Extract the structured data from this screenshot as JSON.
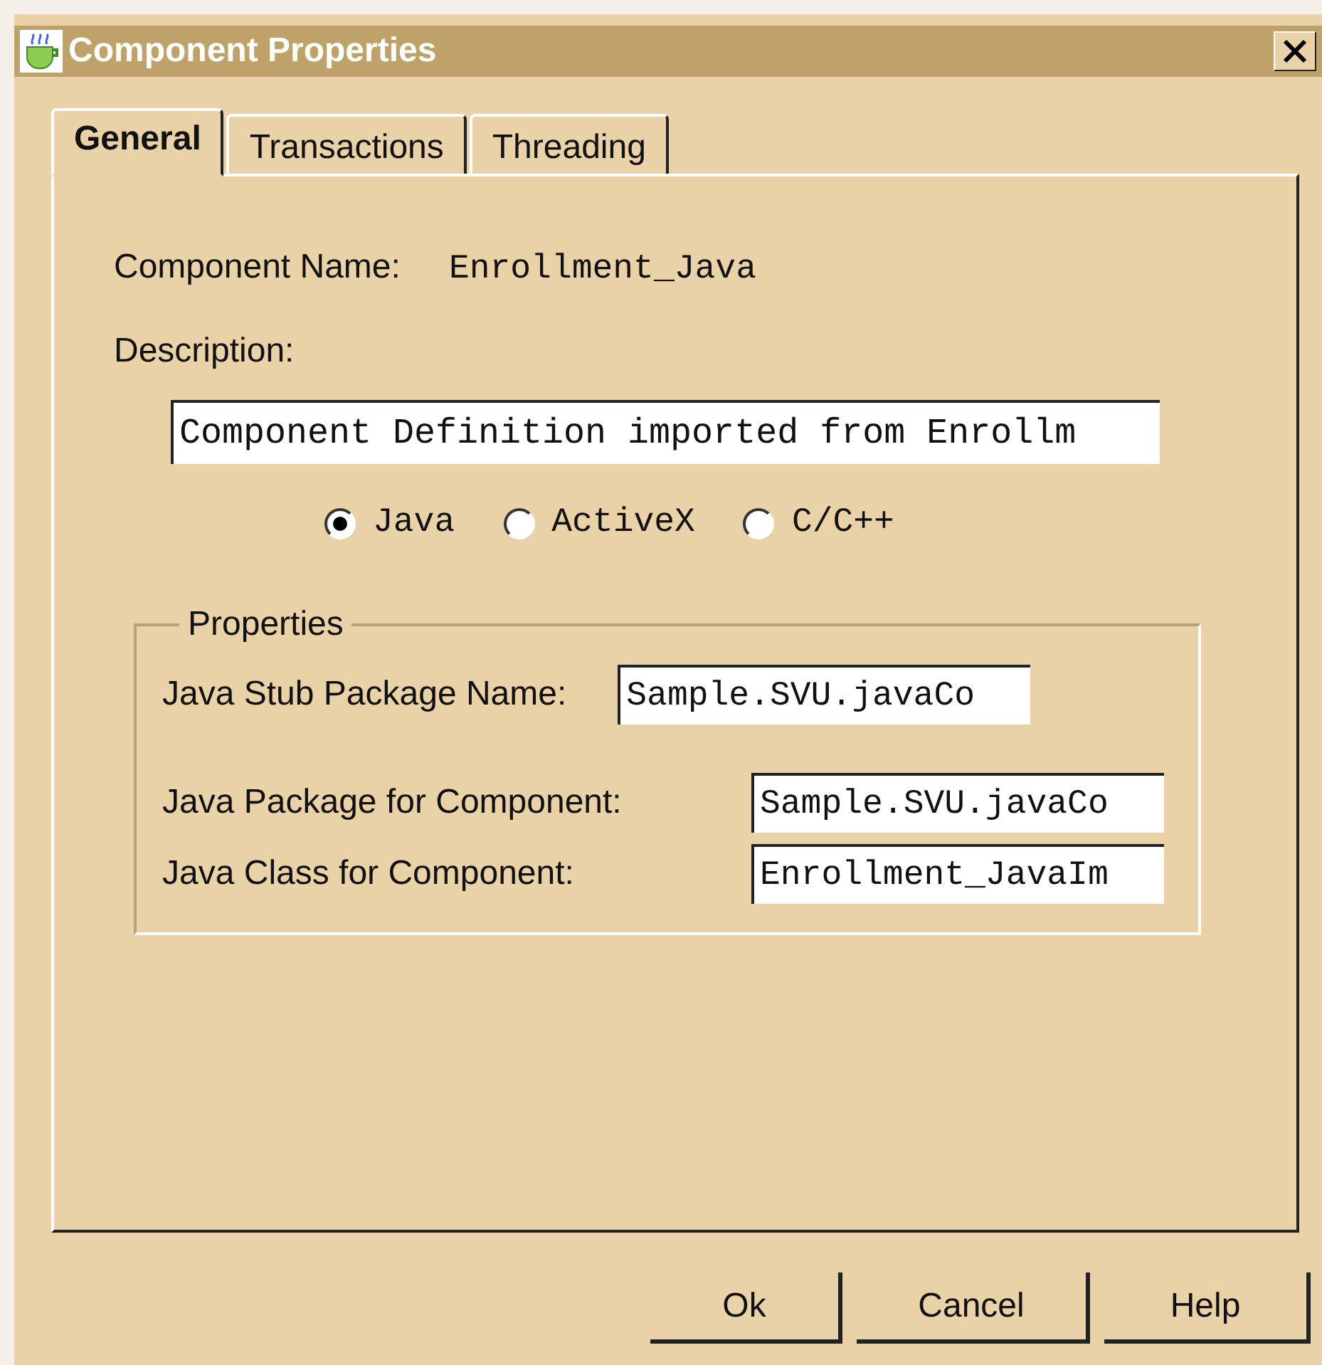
{
  "window": {
    "title": "Component Properties"
  },
  "tabs": [
    {
      "label": "General",
      "selected": true
    },
    {
      "label": "Transactions",
      "selected": false
    },
    {
      "label": "Threading",
      "selected": false
    }
  ],
  "component_name": {
    "label": "Component Name:",
    "value": "Enrollment_Java"
  },
  "description": {
    "label": "Description:",
    "value": "Component Definition imported from Enrollm"
  },
  "component_type": [
    {
      "label": "Java",
      "selected": true
    },
    {
      "label": "ActiveX",
      "selected": false
    },
    {
      "label": "C/C++",
      "selected": false
    }
  ],
  "properties": {
    "title": "Properties",
    "fields": [
      {
        "label": "Java Stub Package Name:",
        "value": "Sample.SVU.javaCo"
      },
      {
        "label": "Java Package for Component:",
        "value": "Sample.SVU.javaCo"
      },
      {
        "label": "Java Class for Component:",
        "value": "Enrollment_JavaIm"
      }
    ]
  },
  "buttons": [
    "Ok",
    "Cancel",
    "Help"
  ]
}
